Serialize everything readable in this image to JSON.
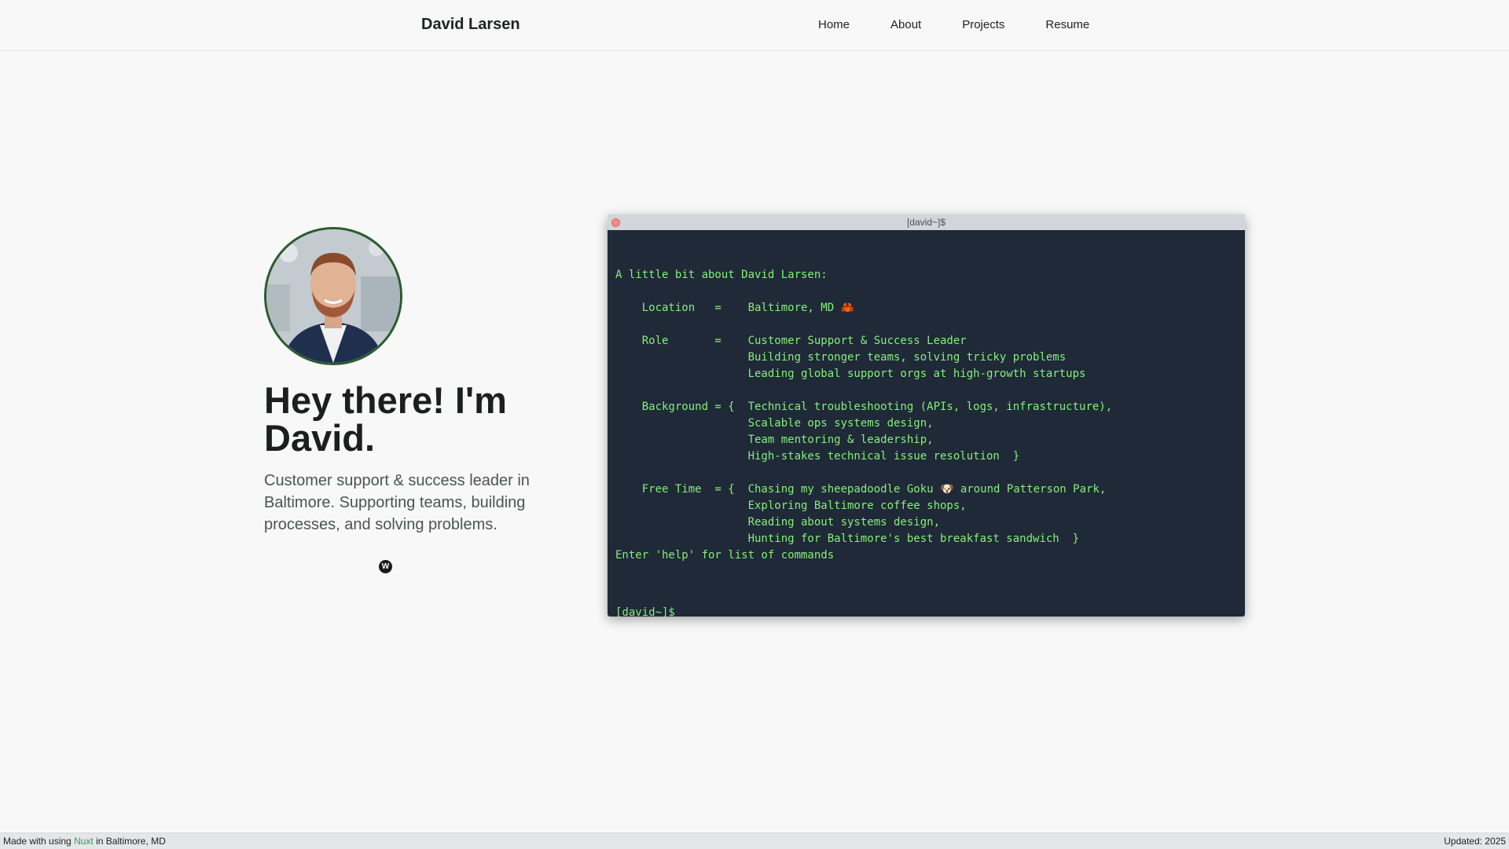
{
  "header": {
    "brand": "David Larsen",
    "nav": [
      "Home",
      "About",
      "Projects",
      "Resume"
    ]
  },
  "hero": {
    "headline": "Hey there! I'm David.",
    "subline": "Customer support & success leader in Baltimore. Supporting teams, building processes, and solving problems.",
    "social_icon": "W"
  },
  "terminal": {
    "title": "[david~]$",
    "lines": [
      "A little bit about David Larsen:",
      "",
      "    Location   =    Baltimore, MD 🦀",
      "",
      "    Role       =    Customer Support & Success Leader",
      "                    Building stronger teams, solving tricky problems",
      "                    Leading global support orgs at high-growth startups",
      "",
      "    Background = {  Technical troubleshooting (APIs, logs, infrastructure),",
      "                    Scalable ops systems design,",
      "                    Team mentoring & leadership,",
      "                    High-stakes technical issue resolution  }",
      "",
      "    Free Time  = {  Chasing my sheepadoodle Goku 🐶 around Patterson Park,",
      "                    Exploring Baltimore coffee shops,",
      "                    Reading about systems design,",
      "                    Hunting for Baltimore's best breakfast sandwich  }",
      "Enter 'help' for list of commands"
    ],
    "prompt": "[david~]$",
    "input_value": ""
  },
  "footer": {
    "made_with": "Made with using",
    "nuxt": "Nuxt",
    "location": "in Baltimore, MD",
    "updated": "Updated: 2025"
  }
}
